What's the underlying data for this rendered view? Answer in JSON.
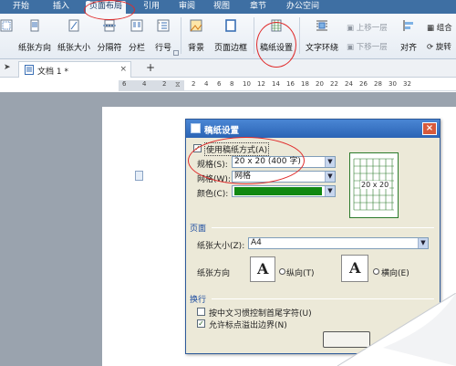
{
  "menu": {
    "tabs": [
      "开始",
      "插入",
      "页面布局",
      "引用",
      "审阅",
      "视图",
      "章节",
      "办公空间"
    ],
    "active": "页面布局"
  },
  "ribbon": {
    "margins": "",
    "paper_orientation": "纸张方向",
    "paper_size": "纸张大小",
    "breaks": "分隔符",
    "columns": "分栏",
    "line_numbers": "行号",
    "background": "背景",
    "page_border": "页面边框",
    "manuscript_setup": "稿纸设置",
    "text_wrap": "文字环绕",
    "bring_forward": "上移一层",
    "send_backward": "下移一层",
    "align": "对齐",
    "group": "组合",
    "rotate": "旋转"
  },
  "doc_tab": {
    "title": "文档 1 *",
    "add": "+"
  },
  "ruler": {
    "numbers": [
      "6",
      "4",
      "2",
      "2",
      "4",
      "6",
      "8",
      "10",
      "12",
      "14",
      "16",
      "18",
      "20",
      "22",
      "24",
      "26",
      "28",
      "30",
      "32"
    ]
  },
  "dialog": {
    "title": "稿纸设置",
    "close": "×",
    "use_manuscript": "使用稿纸方式(A)",
    "use_manuscript_checked": true,
    "spec_label": "规格(S):",
    "spec_value": "20 x 20 (400 字)",
    "grid_label": "网格(W):",
    "grid_value": "网格",
    "color_label": "颜色(C):",
    "color_value": "#118811",
    "preview_label": "20 x 20",
    "page_section": "页面",
    "paper_size_label": "纸张大小(Z):",
    "paper_size_value": "A4",
    "orientation_label": "纸张方向",
    "portrait": "纵向(T)",
    "landscape": "横向(E)",
    "portrait_icon": "A",
    "landscape_icon": "A",
    "orientation_selected": "portrait",
    "wrap_section": "换行",
    "opt_chinese": "按中文习惯控制首尾字符(U)",
    "opt_chinese_checked": false,
    "opt_punct": "允许标点溢出边界(N)",
    "opt_punct_checked": true
  },
  "colors": {
    "menubar": "#3e6fa3",
    "annotation": "#e02b2b",
    "grid_green": "#2b7a2b"
  }
}
